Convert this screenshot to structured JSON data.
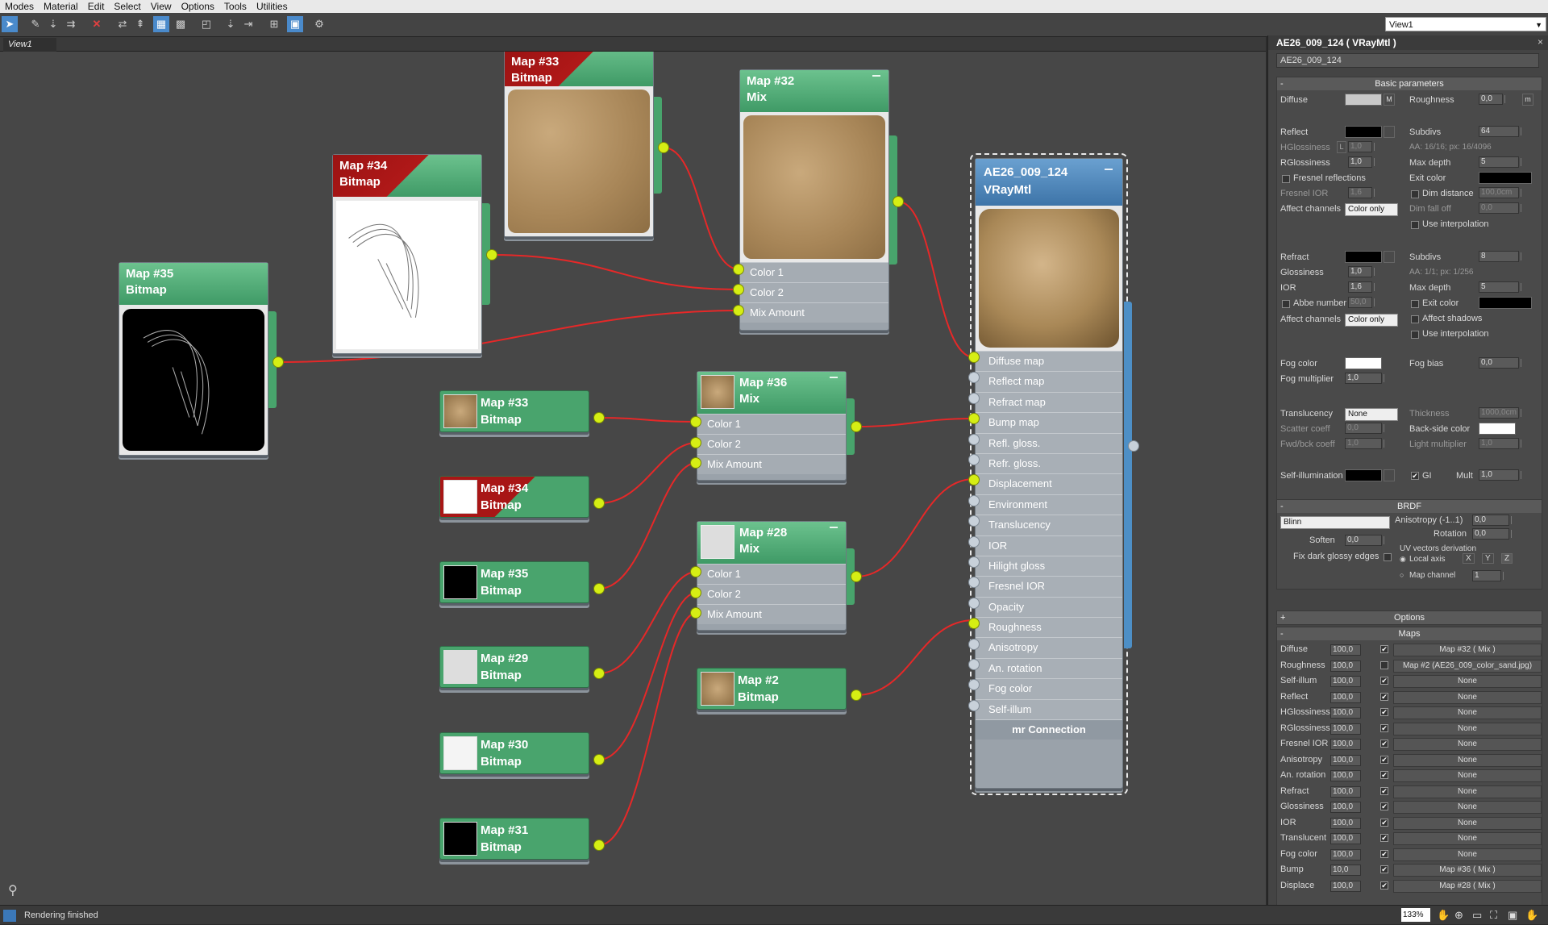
{
  "menu": [
    "Modes",
    "Material",
    "Edit",
    "Select",
    "View",
    "Options",
    "Tools",
    "Utilities"
  ],
  "view_selector": "View1",
  "view_tab": "View1",
  "nodes": {
    "map33_top": {
      "name": "Map #33",
      "type": "Bitmap"
    },
    "map34_top": {
      "name": "Map #34",
      "type": "Bitmap"
    },
    "map35_top": {
      "name": "Map #35",
      "type": "Bitmap"
    },
    "map32": {
      "name": "Map #32",
      "type": "Mix",
      "slots": [
        "Color 1",
        "Color 2",
        "Mix Amount"
      ]
    },
    "map36": {
      "name": "Map #36",
      "type": "Mix",
      "slots": [
        "Color 1",
        "Color 2",
        "Mix Amount"
      ]
    },
    "map28": {
      "name": "Map #28",
      "type": "Mix",
      "slots": [
        "Color 1",
        "Color 2",
        "Mix Amount"
      ]
    },
    "map2": {
      "name": "Map #2",
      "type": "Bitmap"
    },
    "small": [
      {
        "name": "Map #33",
        "type": "Bitmap"
      },
      {
        "name": "Map #34",
        "type": "Bitmap"
      },
      {
        "name": "Map #35",
        "type": "Bitmap"
      },
      {
        "name": "Map #29",
        "type": "Bitmap"
      },
      {
        "name": "Map #30",
        "type": "Bitmap"
      },
      {
        "name": "Map #31",
        "type": "Bitmap"
      }
    ],
    "vray": {
      "name": "AE26_009_124",
      "type": "VRayMtl",
      "slots": [
        "Diffuse map",
        "Reflect map",
        "Refract map",
        "Bump map",
        "Refl. gloss.",
        "Refr. gloss.",
        "Displacement",
        "Environment",
        "Translucency",
        "IOR",
        "Hilight gloss",
        "Fresnel IOR",
        "Opacity",
        "Roughness",
        "Anisotropy",
        "An. rotation",
        "Fog color",
        "Self-illum"
      ],
      "footer": "mr Connection"
    }
  },
  "status": "Rendering finished",
  "zoom": "133%",
  "panel": {
    "title": "AE26_009_124  ( VRayMtl )",
    "name_field": "AE26_009_124",
    "basic": {
      "header": "Basic parameters",
      "diffuse": "Diffuse",
      "m": "M",
      "roughness": "Roughness",
      "roughness_val": "0,0",
      "m2": "m",
      "reflect": "Reflect",
      "subdivs": "Subdivs",
      "subdivs_val": "64",
      "hgloss": "HGlossiness",
      "l": "L",
      "hgloss_val": "1,0",
      "aa": "AA: 16/16; px: 16/4096",
      "rgloss": "RGlossiness",
      "rgloss_val": "1,0",
      "maxdepth": "Max depth",
      "maxdepth_val": "5",
      "fresnel": "Fresnel reflections",
      "exitcolor": "Exit color",
      "fresnel_ior": "Fresnel IOR",
      "fior_val": "1,6",
      "dimdist": "Dim distance",
      "dimdist_val": "100,0cm",
      "affect": "Affect channels",
      "affect_val": "Color only",
      "dimfall": "Dim fall off",
      "dimfall_val": "0,0",
      "useinterp": "Use interpolation",
      "refract": "Refract",
      "rsubdivs": "Subdivs",
      "rsubdivs_val": "8",
      "glossiness": "Glossiness",
      "gloss_val": "1,0",
      "aa2": "AA: 1/1; px: 1/256",
      "ior": "IOR",
      "ior_val": "1,6",
      "rmaxdepth": "Max depth",
      "rmaxdepth_val": "5",
      "abbe": "Abbe number",
      "abbe_val": "50,0",
      "rexit": "Exit color",
      "raffect": "Affect channels",
      "raffect_val": "Color only",
      "affshadows": "Affect shadows",
      "ruseinterp": "Use interpolation",
      "fogcolor": "Fog color",
      "fogbias": "Fog bias",
      "fogbias_val": "0,0",
      "fogmult": "Fog multiplier",
      "fogmult_val": "1,0",
      "transl": "Translucency",
      "transl_val": "None",
      "thickness": "Thickness",
      "thickness_val": "1000,0cm",
      "scatter": "Scatter coeff",
      "scatter_val": "0,0",
      "backside": "Back-side color",
      "fwdbck": "Fwd/bck coeff",
      "fwdbck_val": "1,0",
      "lightmult": "Light multiplier",
      "lightmult_val": "1,0",
      "selfillum": "Self-illumination",
      "gi": "GI",
      "mult": "Mult",
      "mult_val": "1,0"
    },
    "brdf": {
      "header": "BRDF",
      "type": "Blinn",
      "aniso": "Anisotropy (-1..1)",
      "aniso_val": "0,0",
      "rotation": "Rotation",
      "rotation_val": "0,0",
      "soften": "Soften",
      "soften_val": "0,0",
      "uvderiv": "UV vectors derivation",
      "fixdark": "Fix dark glossy edges",
      "localaxis": "Local axis",
      "x": "X",
      "y": "Y",
      "z": "Z",
      "mapchannel": "Map channel",
      "mapchannel_val": "1"
    },
    "options_header": "Options",
    "maps_header": "Maps",
    "maps": [
      {
        "name": "Diffuse",
        "amt": "100,0",
        "on": "✔",
        "map": "Map #32  ( Mix )"
      },
      {
        "name": "Roughness",
        "amt": "100,0",
        "on": "",
        "map": "Map #2 (AE26_009_color_sand.jpg)"
      },
      {
        "name": "Self-illum",
        "amt": "100,0",
        "on": "✔",
        "map": "None"
      },
      {
        "name": "Reflect",
        "amt": "100,0",
        "on": "✔",
        "map": "None"
      },
      {
        "name": "HGlossiness",
        "amt": "100,0",
        "on": "✔",
        "map": "None"
      },
      {
        "name": "RGlossiness",
        "amt": "100,0",
        "on": "✔",
        "map": "None"
      },
      {
        "name": "Fresnel IOR",
        "amt": "100,0",
        "on": "✔",
        "map": "None"
      },
      {
        "name": "Anisotropy",
        "amt": "100,0",
        "on": "✔",
        "map": "None"
      },
      {
        "name": "An. rotation",
        "amt": "100,0",
        "on": "✔",
        "map": "None"
      },
      {
        "name": "Refract",
        "amt": "100,0",
        "on": "✔",
        "map": "None"
      },
      {
        "name": "Glossiness",
        "amt": "100,0",
        "on": "✔",
        "map": "None"
      },
      {
        "name": "IOR",
        "amt": "100,0",
        "on": "✔",
        "map": "None"
      },
      {
        "name": "Translucent",
        "amt": "100,0",
        "on": "✔",
        "map": "None"
      },
      {
        "name": "Fog color",
        "amt": "100,0",
        "on": "✔",
        "map": "None"
      },
      {
        "name": "Bump",
        "amt": "10,0",
        "on": "✔",
        "map": "Map #36  ( Mix )"
      },
      {
        "name": "Displace",
        "amt": "100,0",
        "on": "✔",
        "map": "Map #28  ( Mix )"
      }
    ]
  }
}
